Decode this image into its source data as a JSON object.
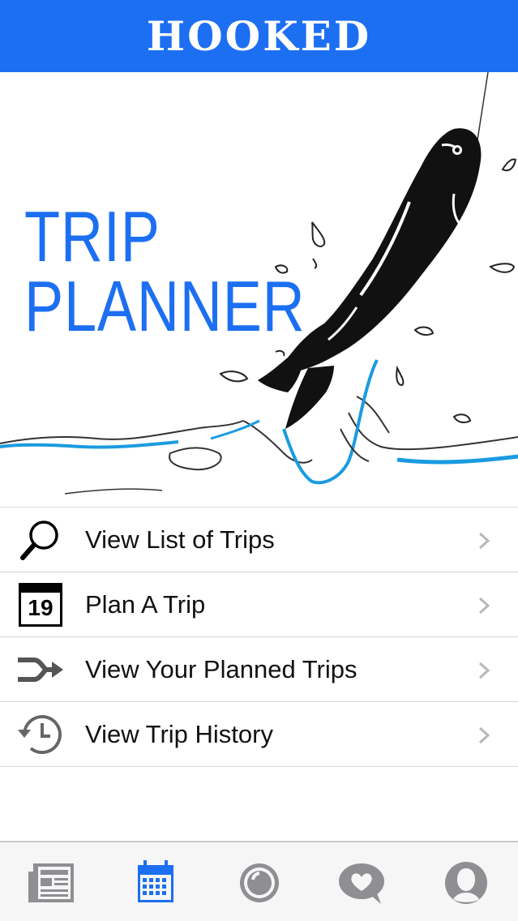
{
  "header": {
    "brand": "HOOKED"
  },
  "hero": {
    "title_line1": "TRIP",
    "title_line2": "PLANNER"
  },
  "menu": {
    "items": [
      {
        "label": "View List of Trips",
        "icon": "search-icon"
      },
      {
        "label": "Plan A Trip",
        "icon": "calendar-19-icon",
        "icon_text": "19"
      },
      {
        "label": "View Your Planned Trips",
        "icon": "merge-arrow-icon"
      },
      {
        "label": "View Trip History",
        "icon": "history-clock-icon"
      }
    ]
  },
  "tabbar": {
    "tabs": [
      {
        "icon": "news-icon",
        "active": false
      },
      {
        "icon": "calendar-icon",
        "active": true
      },
      {
        "icon": "camera-lens-icon",
        "active": false
      },
      {
        "icon": "chat-heart-icon",
        "active": false
      },
      {
        "icon": "profile-icon",
        "active": false
      }
    ]
  },
  "colors": {
    "brand_blue": "#1d6ff2",
    "water_blue": "#1a9be0",
    "inactive_gray": "#8e8e93"
  }
}
